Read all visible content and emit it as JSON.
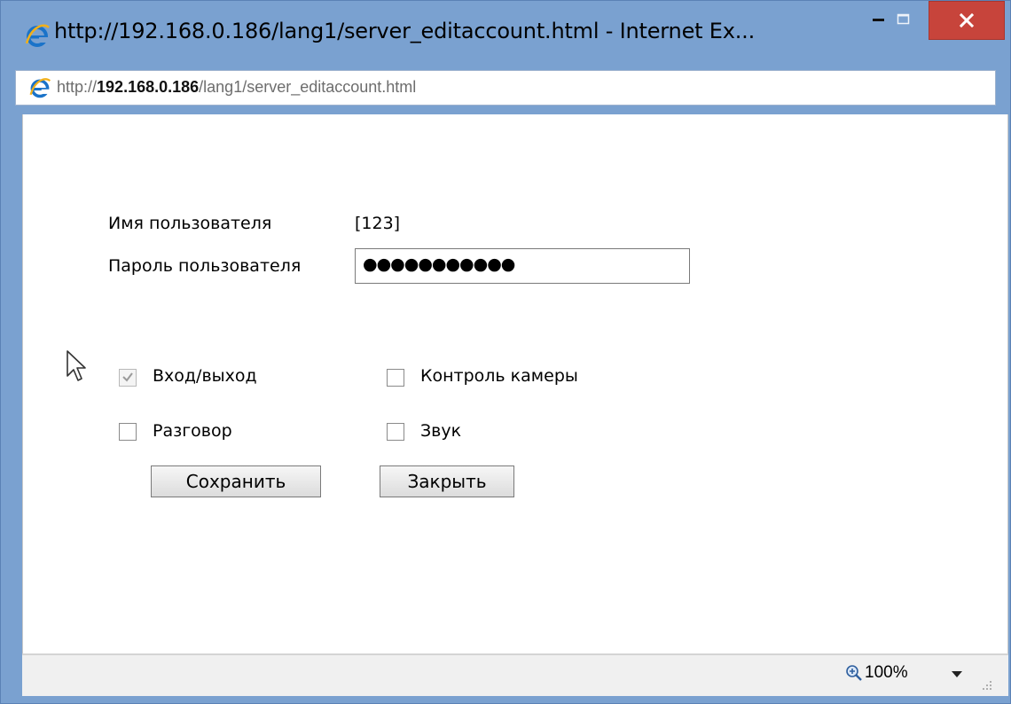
{
  "window": {
    "title": "http://192.168.0.186/lang1/server_editaccount.html - Internet Ex...",
    "minimize_glyph": "−",
    "close_glyph": "×"
  },
  "address": {
    "scheme": "http://",
    "host": "192.168.0.186",
    "path": "/lang1/server_editaccount.html"
  },
  "form": {
    "username_label": "Имя пользователя",
    "username_value": "[123]",
    "password_label": "Пароль пользователя",
    "password_value": "●●●●●●●●●●●",
    "permissions": [
      {
        "label": "Вход/выход",
        "checked": true
      },
      {
        "label": "Контроль камеры",
        "checked": false
      },
      {
        "label": "Разговор",
        "checked": false
      },
      {
        "label": "Звук",
        "checked": false
      }
    ],
    "save_label": "Сохранить",
    "close_label": "Закрыть"
  },
  "status": {
    "zoom": "100%"
  },
  "colors": {
    "titlebar": "#7aa1d0",
    "close_button": "#c7443b"
  }
}
